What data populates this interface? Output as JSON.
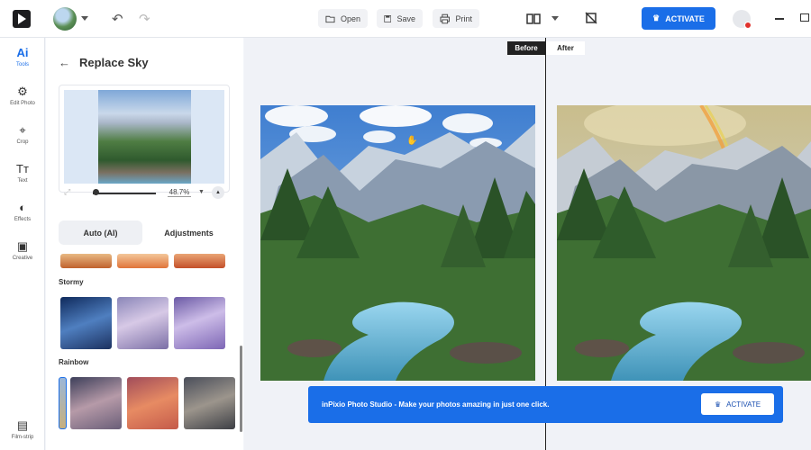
{
  "topbar": {
    "open_label": "Open",
    "save_label": "Save",
    "print_label": "Print",
    "activate_label": "ACTIVATE"
  },
  "rail": {
    "items": [
      {
        "glyph": "Ai",
        "label": "Tools"
      },
      {
        "glyph": "",
        "label": "Edit Photo"
      },
      {
        "glyph": "",
        "label": "Crop"
      },
      {
        "glyph": "Tт",
        "label": "Text"
      },
      {
        "glyph": "",
        "label": "Effects"
      },
      {
        "glyph": "",
        "label": "Creative"
      },
      {
        "glyph": "",
        "label": "Film-strip"
      }
    ]
  },
  "panel": {
    "title": "Replace Sky",
    "zoom_value": "48.7%",
    "zoom_level": 0.05,
    "tabs": [
      {
        "label": "Auto (AI)"
      },
      {
        "label": "Adjustments"
      }
    ],
    "sections": [
      {
        "label": "Stormy"
      },
      {
        "label": "Rainbow"
      }
    ]
  },
  "canvas": {
    "before_label": "Before",
    "after_label": "After"
  },
  "banner": {
    "text": "inPixio Photo Studio - Make your photos amazing in just one click.",
    "activate_label": "ACTIVATE"
  },
  "colors": {
    "accent": "#1a6ee8",
    "divider": "#222222"
  }
}
